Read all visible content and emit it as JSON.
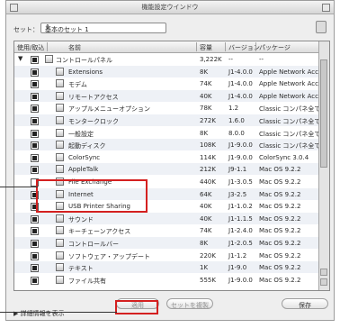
{
  "window": {
    "title": "機能設定ウインドウ",
    "close_icon": "close-icon",
    "zoom_icon": "zoom-icon"
  },
  "set_row": {
    "label": "セット：",
    "selected": "基本のセット 1",
    "select_arrows": "⇕"
  },
  "header": {
    "check": "使用/取込",
    "name": "名前",
    "size": "容量",
    "version": "バージョン",
    "package": "パッケージ"
  },
  "rows": [
    {
      "indent": 0,
      "tri": "▼",
      "checked": "on",
      "name": "コントロールパネル",
      "size": "3,222K",
      "version": "--",
      "package": "--"
    },
    {
      "indent": 1,
      "checked": "on",
      "name": "Extensions",
      "size": "8K",
      "version": "J1-4.0.0",
      "package": "Apple Network Access"
    },
    {
      "indent": 1,
      "checked": "on",
      "name": "モデム",
      "size": "74K",
      "version": "J1-4.0.0",
      "package": "Apple Network Access"
    },
    {
      "indent": 1,
      "checked": "on",
      "name": "リモートアクセス",
      "size": "40K",
      "version": "J1-4.0.0",
      "package": "Apple Network Access"
    },
    {
      "indent": 1,
      "checked": "on",
      "name": "アップルメニューオプション",
      "size": "78K",
      "version": "1.2",
      "package": "Classic コンパネ全て"
    },
    {
      "indent": 1,
      "checked": "on",
      "name": "モンタークロック",
      "size": "272K",
      "version": "1.6.0",
      "package": "Classic コンパネ全て"
    },
    {
      "indent": 1,
      "checked": "on",
      "name": "一般設定",
      "size": "8K",
      "version": "8.0.0",
      "package": "Classic コンパネ全て"
    },
    {
      "indent": 1,
      "checked": "on",
      "name": "起動ディスク",
      "size": "108K",
      "version": "J1-9.0.0",
      "package": "Classic コンパネ全て"
    },
    {
      "indent": 1,
      "checked": "on",
      "name": "ColorSync",
      "size": "114K",
      "version": "J1-9.0.0",
      "package": "ColorSync 3.0.4"
    },
    {
      "indent": 1,
      "checked": "on",
      "name": "AppleTalk",
      "size": "212K",
      "version": "J9-1.1",
      "package": "Mac OS 9.2.2"
    },
    {
      "indent": 1,
      "checked": "off",
      "name": "File Exchange",
      "size": "440K",
      "version": "J1-3.0.5",
      "package": "Mac OS 9.2.2"
    },
    {
      "indent": 1,
      "checked": "on",
      "name": "Internet",
      "size": "64K",
      "version": "J3-2.5",
      "package": "Mac OS 9.2.2"
    },
    {
      "indent": 1,
      "checked": "on",
      "name": "USB Printer Sharing",
      "size": "40K",
      "version": "J1-1.0.2",
      "package": "Mac OS 9.2.2"
    },
    {
      "indent": 1,
      "checked": "on",
      "name": "サウンド",
      "size": "40K",
      "version": "J1-1.1.5",
      "package": "Mac OS 9.2.2"
    },
    {
      "indent": 1,
      "checked": "on",
      "name": "キーチェーンアクセス",
      "size": "74K",
      "version": "J1-2.4.0",
      "package": "Mac OS 9.2.2"
    },
    {
      "indent": 1,
      "checked": "on",
      "name": "コントロールバー",
      "size": "8K",
      "version": "J1-2.0.5",
      "package": "Mac OS 9.2.2"
    },
    {
      "indent": 1,
      "checked": "on",
      "name": "ソフトウェア・アップデート",
      "size": "220K",
      "version": "J1-1.2",
      "package": "Mac OS 9.2.2"
    },
    {
      "indent": 1,
      "checked": "on",
      "name": "テキスト",
      "size": "1K",
      "version": "J1-9.0",
      "package": "Mac OS 9.2.2"
    },
    {
      "indent": 1,
      "checked": "on",
      "name": "ファイル共有",
      "size": "555K",
      "version": "J1-9.0.0",
      "package": "Mac OS 9.2.2"
    }
  ],
  "buttons": {
    "apply": "適用",
    "duplicate": "セットを複製",
    "save": "保存"
  },
  "footer": {
    "disclosure": "▶",
    "label": "詳細情報を表示"
  },
  "accent": "#d42020"
}
